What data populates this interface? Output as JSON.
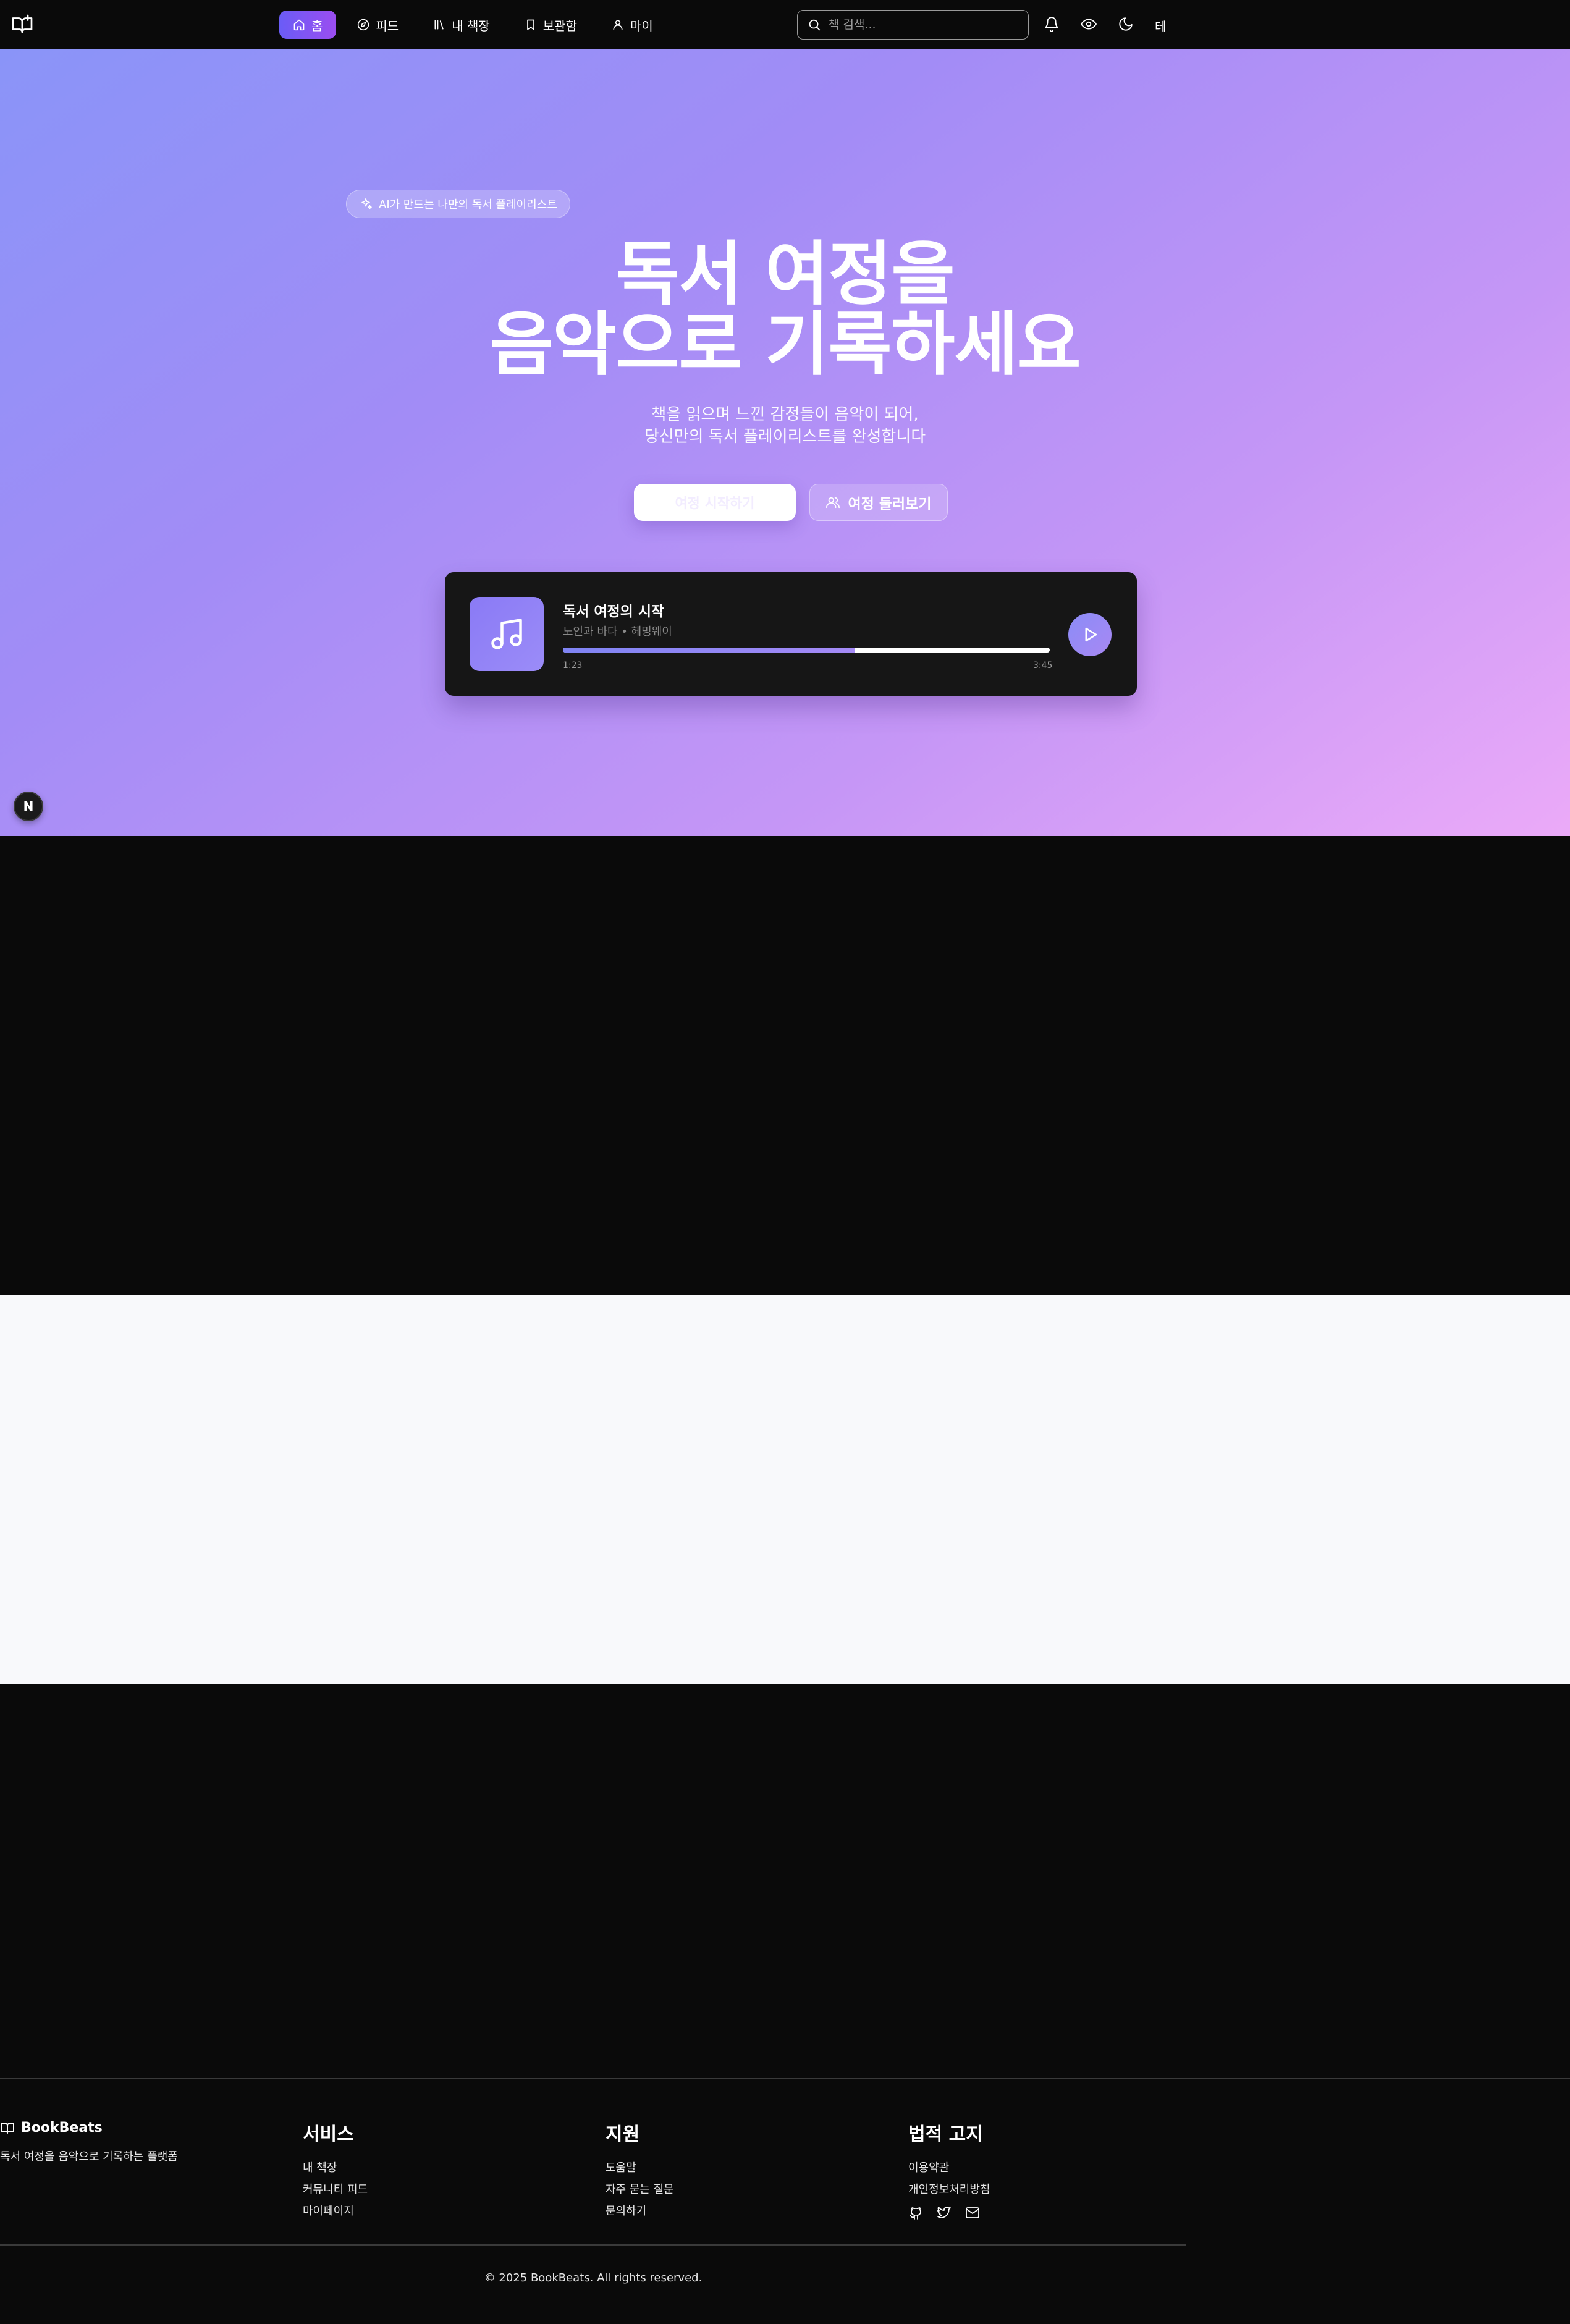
{
  "header": {
    "nav": [
      {
        "label": "홈",
        "icon": "home-icon",
        "active": true
      },
      {
        "label": "피드",
        "icon": "compass-icon",
        "active": false
      },
      {
        "label": "내 책장",
        "icon": "library-icon",
        "active": false
      },
      {
        "label": "보관함",
        "icon": "bookmark-icon",
        "active": false
      },
      {
        "label": "마이",
        "icon": "user-icon",
        "active": false
      }
    ],
    "search_placeholder": "책 검색...",
    "lang_label": "테"
  },
  "hero": {
    "badge": "AI가 만드는 나만의 독서 플레이리스트",
    "title_line1": "독서 여정을",
    "title_line2": "음악으로 기록하세요",
    "subtitle_line1": "책을 읽으며 느낀 감정들이 음악이 되어,",
    "subtitle_line2": "당신만의 독서 플레이리스트를 완성합니다",
    "primary_button": "여정 시작하기",
    "secondary_button": "여정 둘러보기"
  },
  "player": {
    "title": "독서 여정의 시작",
    "meta": "노인과 바다 • 헤밍웨이",
    "progress": 0.6,
    "current_time": "1:23",
    "total_time": "3:45"
  },
  "dev_badge": "N",
  "footer": {
    "brand": "BookBeats",
    "description": "독서 여정을 음악으로 기록하는 플랫폼",
    "columns": [
      {
        "title": "서비스",
        "links": [
          "내 책장",
          "커뮤니티 피드",
          "마이페이지"
        ]
      },
      {
        "title": "지원",
        "links": [
          "도움말",
          "자주 묻는 질문",
          "문의하기"
        ]
      },
      {
        "title": "법적 고지",
        "links": [
          "이용약관",
          "개인정보처리방침"
        ]
      }
    ],
    "social": [
      "github-icon",
      "twitter-icon",
      "mail-icon"
    ],
    "copyright": "© 2025 BookBeats. All rights reserved."
  },
  "colors": {
    "accent": "#7c5cf6",
    "hero_gradient_start": "#8a94f8",
    "hero_gradient_end": "#ebaaf8",
    "dark_bg": "#0a0a0a",
    "light_bg": "#f8f9fb"
  }
}
